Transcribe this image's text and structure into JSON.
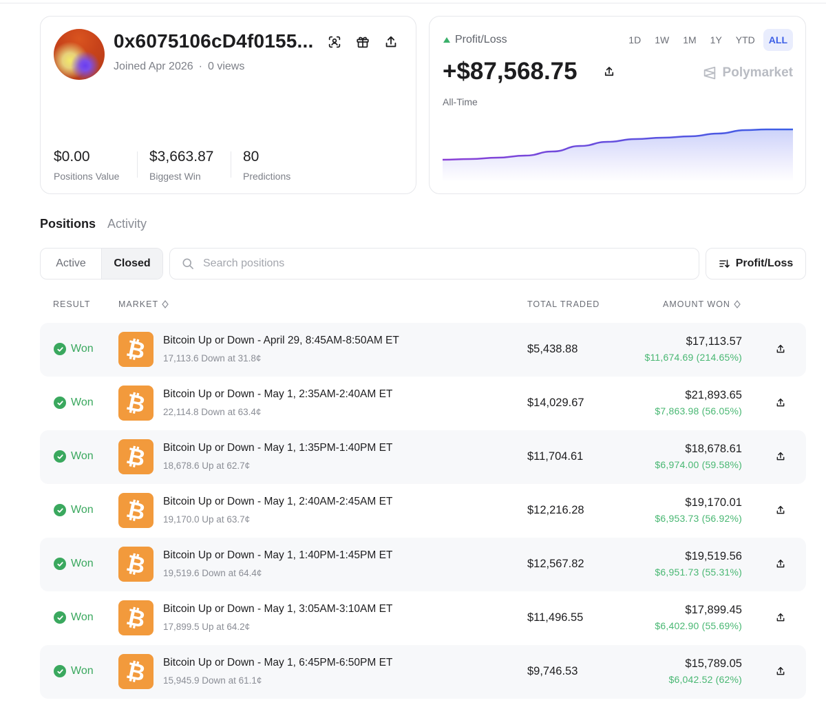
{
  "profile": {
    "wallet": "0x6075106cD4f0155...",
    "joined": "Joined Apr 2026",
    "views": "0 views",
    "stats": [
      {
        "value": "$0.00",
        "label": "Positions Value"
      },
      {
        "value": "$3,663.87",
        "label": "Biggest Win"
      },
      {
        "value": "80",
        "label": "Predictions"
      }
    ],
    "icons": [
      "scan-icon",
      "gift-icon",
      "share-icon"
    ]
  },
  "pnl": {
    "title": "Profit/Loss",
    "amount": "+$87,568.75",
    "period_label": "All-Time",
    "brand": "Polymarket",
    "ranges": [
      "1D",
      "1W",
      "1M",
      "1Y",
      "YTD",
      "ALL"
    ],
    "active_range": "ALL",
    "up_color": "#3ab06a",
    "line_gradient": [
      "#8b3fd6",
      "#3b5fe6"
    ],
    "curve": [
      [
        0,
        58
      ],
      [
        40,
        57
      ],
      [
        80,
        55
      ],
      [
        120,
        52
      ],
      [
        160,
        46
      ],
      [
        200,
        38
      ],
      [
        240,
        32
      ],
      [
        280,
        28
      ],
      [
        320,
        26
      ],
      [
        360,
        24
      ],
      [
        400,
        20
      ],
      [
        440,
        15
      ],
      [
        470,
        14
      ],
      [
        509,
        14
      ]
    ]
  },
  "tabs": [
    {
      "label": "Positions",
      "active": true
    },
    {
      "label": "Activity",
      "active": false
    }
  ],
  "filters": {
    "status_options": [
      "Active",
      "Closed"
    ],
    "status_selected": "Closed",
    "search_placeholder": "Search positions",
    "search_value": "",
    "sort_label": "Profit/Loss"
  },
  "table": {
    "headers": {
      "result": "RESULT",
      "market": "MARKET",
      "total_traded": "TOTAL TRADED",
      "amount_won": "AMOUNT WON"
    },
    "rows": [
      {
        "result": "Won",
        "title": "Bitcoin Up or Down - April 29, 8:45AM-8:50AM ET",
        "sub": "17,113.6 Down at 31.8¢",
        "traded": "$5,438.88",
        "won": "$17,113.57",
        "gain": "$11,674.69 (214.65%)"
      },
      {
        "result": "Won",
        "title": "Bitcoin Up or Down - May 1, 2:35AM-2:40AM ET",
        "sub": "22,114.8 Down at 63.4¢",
        "traded": "$14,029.67",
        "won": "$21,893.65",
        "gain": "$7,863.98 (56.05%)"
      },
      {
        "result": "Won",
        "title": "Bitcoin Up or Down - May 1, 1:35PM-1:40PM ET",
        "sub": "18,678.6 Up at 62.7¢",
        "traded": "$11,704.61",
        "won": "$18,678.61",
        "gain": "$6,974.00 (59.58%)"
      },
      {
        "result": "Won",
        "title": "Bitcoin Up or Down - May 1, 2:40AM-2:45AM ET",
        "sub": "19,170.0 Up at 63.7¢",
        "traded": "$12,216.28",
        "won": "$19,170.01",
        "gain": "$6,953.73 (56.92%)"
      },
      {
        "result": "Won",
        "title": "Bitcoin Up or Down - May 1, 1:40PM-1:45PM ET",
        "sub": "19,519.6 Down at 64.4¢",
        "traded": "$12,567.82",
        "won": "$19,519.56",
        "gain": "$6,951.73 (55.31%)"
      },
      {
        "result": "Won",
        "title": "Bitcoin Up or Down - May 1, 3:05AM-3:10AM ET",
        "sub": "17,899.5 Up at 64.2¢",
        "traded": "$11,496.55",
        "won": "$17,899.45",
        "gain": "$6,402.90 (55.69%)"
      },
      {
        "result": "Won",
        "title": "Bitcoin Up or Down - May 1, 6:45PM-6:50PM ET",
        "sub": "15,945.9 Down at 61.1¢",
        "traded": "$9,746.53",
        "won": "$15,789.05",
        "gain": "$6,042.52 (62%)"
      }
    ],
    "market_icon": "bitcoin-icon",
    "win_color": "#3aa85e"
  }
}
